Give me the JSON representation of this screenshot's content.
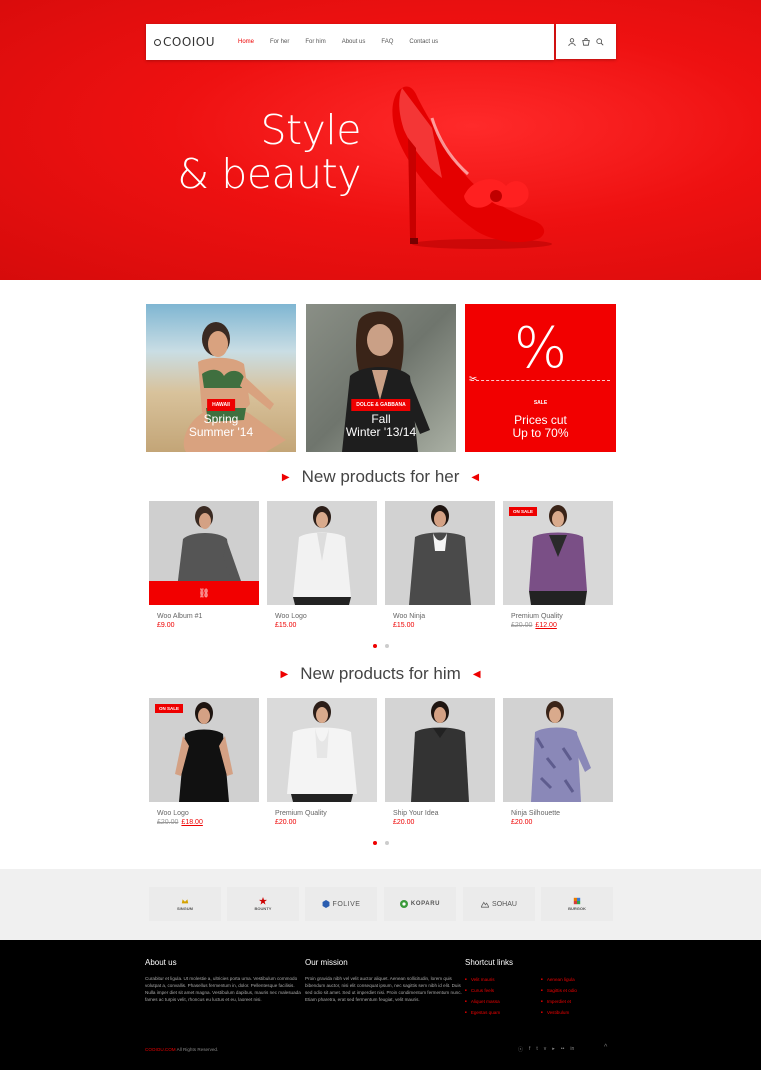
{
  "brand": {
    "logo": "COOIOU",
    "accent": "#e00000"
  },
  "nav": {
    "items": [
      {
        "label": "Home",
        "active": true
      },
      {
        "label": "For her"
      },
      {
        "label": "For him"
      },
      {
        "label": "About us"
      },
      {
        "label": "FAQ"
      },
      {
        "label": "Contact us"
      }
    ],
    "icons": [
      "user-icon",
      "cart-icon",
      "search-icon"
    ]
  },
  "hero": {
    "line1": "Style",
    "line2": "& beauty"
  },
  "banners": [
    {
      "label": "HAWAII",
      "line1": "Spring",
      "line2": "Summer '14"
    },
    {
      "label": "DOLCE & GABBANA",
      "line1": "Fall",
      "line2": "Winter '13/14"
    },
    {
      "symbol": "%",
      "label": "SALE",
      "line1": "Prices cut",
      "line2": "Up to 70%"
    }
  ],
  "sections": {
    "her": {
      "title": "New products for her",
      "products": [
        {
          "name": "Woo Album #1",
          "price": "£9.00"
        },
        {
          "name": "Woo Logo",
          "price": "£15.00"
        },
        {
          "name": "Woo Ninja",
          "price": "£15.00"
        },
        {
          "name": "Premium Quality",
          "old_price": "£20.00",
          "price": "£12.00",
          "badge": "ON SALE"
        }
      ]
    },
    "him": {
      "title": "New products for him",
      "products": [
        {
          "name": "Woo Logo",
          "old_price": "£20.00",
          "price": "£18.00",
          "badge": "ON SALE"
        },
        {
          "name": "Premium Quality",
          "price": "£20.00"
        },
        {
          "name": "Ship Your Idea",
          "price": "£20.00"
        },
        {
          "name": "Ninja Silhouette",
          "price": "£20.00"
        }
      ]
    }
  },
  "brands": [
    "SINGUM",
    "BOUNTY",
    "FOLIVE",
    "KOPARU",
    "SOHAU",
    "BURGOK"
  ],
  "footer": {
    "about": {
      "title": "About us",
      "text": "Curabitur et ligula. Ut molestie a, ultricies porta urna. Vestibulum commodo volutpat a, convallis. Phasellus fermentum in, dolor. Pellentesque facilisis. Nulla imper diet sit amet magna. Vestibulum dapibus, mauris nec malesuada fames ac turpis velit, rhoncus eu luctus et eu, laoreet nisi."
    },
    "mission": {
      "title": "Our mission",
      "text": "Proin gravida nibh vel velit auctor aliquet. Aenean sollicitudin, lorem quis bibendum auctor, nisi elit consequat ipsum, nec sagittis sem nibh id elit. Duis sed odio sit amet. Sed ut imperdiet nisi. Proin condimentum fermentum nunc. Etiam pharetra, erat sed fermentum feugiat, velit mauris."
    },
    "shortcuts": {
      "title": "Shortcut links",
      "col1": [
        "Velit mauris",
        "Curus feels",
        "Aliquet massa",
        "Egestas quam"
      ],
      "col2": [
        "Aenean ligula",
        "Sagittis et odio",
        "Imperdiet et",
        "Vestibulum"
      ]
    },
    "copyright_red": "COOIOU.COM",
    "copyright": " All Rights Reserved.",
    "social": [
      "skype-icon",
      "facebook-icon",
      "twitter-icon",
      "vimeo-icon",
      "youtube-icon",
      "flickr-icon",
      "linkedin-icon"
    ],
    "to_top": "^"
  }
}
